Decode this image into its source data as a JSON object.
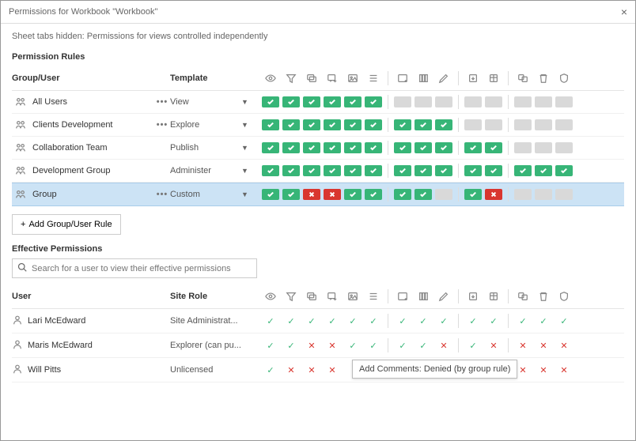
{
  "dialog_title": "Permissions for Workbook \"Workbook\"",
  "subtitle": "Sheet tabs hidden: Permissions for views controlled independently",
  "section_rules": "Permission Rules",
  "header_group": "Group/User",
  "header_template": "Template",
  "perm_columns": [
    "view",
    "filter",
    "comments",
    "add-comment",
    "image",
    "details",
    "sep",
    "web-edit",
    "save",
    "edit",
    "sep",
    "download",
    "download-data",
    "sep",
    "move",
    "delete",
    "set-perms"
  ],
  "rules": [
    {
      "name": "All Users",
      "template": "View",
      "more": true,
      "perms": [
        "allow",
        "allow",
        "allow",
        "allow",
        "allow",
        "allow",
        "sep",
        "none",
        "none",
        "none",
        "sep",
        "none",
        "none",
        "sep",
        "none",
        "none",
        "none"
      ]
    },
    {
      "name": "Clients Development",
      "template": "Explore",
      "more": true,
      "perms": [
        "allow",
        "allow",
        "allow",
        "allow",
        "allow",
        "allow",
        "sep",
        "allow",
        "allow",
        "allow",
        "sep",
        "none",
        "none",
        "sep",
        "none",
        "none",
        "none"
      ]
    },
    {
      "name": "Collaboration Team",
      "template": "Publish",
      "more": false,
      "perms": [
        "allow",
        "allow",
        "allow",
        "allow",
        "allow",
        "allow",
        "sep",
        "allow",
        "allow",
        "allow",
        "sep",
        "allow",
        "allow",
        "sep",
        "none",
        "none",
        "none"
      ]
    },
    {
      "name": "Development Group",
      "template": "Administer",
      "more": false,
      "perms": [
        "allow",
        "allow",
        "allow",
        "allow",
        "allow",
        "allow",
        "sep",
        "allow",
        "allow",
        "allow",
        "sep",
        "allow",
        "allow",
        "sep",
        "allow",
        "allow",
        "allow"
      ]
    },
    {
      "name": "Group",
      "template": "Custom",
      "more": true,
      "selected": true,
      "perms": [
        "allow",
        "allow",
        "deny",
        "deny",
        "allow",
        "allow",
        "sep",
        "allow",
        "allow",
        "none",
        "sep",
        "allow",
        "deny",
        "sep",
        "none",
        "none",
        "none"
      ]
    }
  ],
  "add_rule_label": "Add Group/User Rule",
  "section_effective": "Effective Permissions",
  "search_placeholder": "Search for a user to view their effective permissions",
  "header_user": "User",
  "header_role": "Site Role",
  "effective": [
    {
      "name": "Lari McEdward",
      "role": "Site Administrat...",
      "perms": [
        "allow",
        "allow",
        "allow",
        "allow",
        "allow",
        "allow",
        "sep",
        "allow",
        "allow",
        "allow",
        "sep",
        "allow",
        "allow",
        "sep",
        "allow",
        "allow",
        "allow"
      ]
    },
    {
      "name": "Maris McEdward",
      "role": "Explorer (can pu...",
      "perms": [
        "allow",
        "allow",
        "deny",
        "deny",
        "allow",
        "allow",
        "sep",
        "allow",
        "allow",
        "deny",
        "sep",
        "allow",
        "deny",
        "sep",
        "deny",
        "deny",
        "deny"
      ]
    },
    {
      "name": "Will Pitts",
      "role": "Unlicensed",
      "perms": [
        "allow",
        "deny",
        "deny",
        "deny",
        "tooltip",
        "",
        "sep",
        "",
        "",
        "",
        "sep",
        "allow",
        "deny",
        "sep",
        "deny",
        "deny",
        "deny"
      ]
    }
  ],
  "tooltip_text": "Add Comments: Denied (by group rule)"
}
